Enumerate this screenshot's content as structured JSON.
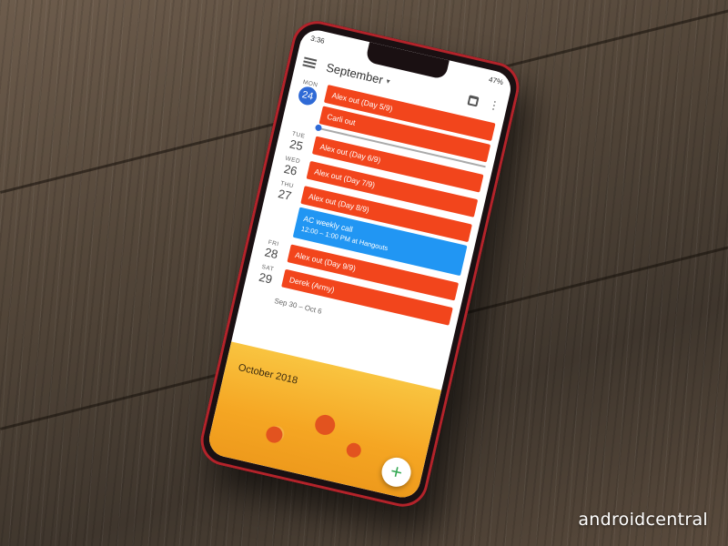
{
  "status": {
    "time": "3:36",
    "battery": "47%"
  },
  "header": {
    "month": "September",
    "caret": "▾",
    "more": "⋮"
  },
  "days": [
    {
      "dow": "MON",
      "num": "24",
      "today": true,
      "events": [
        {
          "title": "Alex out (Day 5/9)",
          "color": "#f2451c"
        },
        {
          "title": "Carli out",
          "color": "#f2451c"
        }
      ],
      "show_now_after_event": true
    },
    {
      "dow": "TUE",
      "num": "25",
      "today": false,
      "events": [
        {
          "title": "Alex out (Day 6/9)",
          "color": "#f2451c"
        }
      ]
    },
    {
      "dow": "WED",
      "num": "26",
      "today": false,
      "events": [
        {
          "title": "Alex out (Day 7/9)",
          "color": "#f2451c"
        }
      ]
    },
    {
      "dow": "THU",
      "num": "27",
      "today": false,
      "events": [
        {
          "title": "Alex out (Day 8/9)",
          "color": "#f2451c"
        },
        {
          "title": "AC weekly call",
          "subtitle": "12:00 – 1:00 PM at Hangouts",
          "color": "#2196f3"
        }
      ]
    },
    {
      "dow": "FRI",
      "num": "28",
      "today": false,
      "events": [
        {
          "title": "Alex out (Day 9/9)",
          "color": "#f2451c"
        }
      ]
    },
    {
      "dow": "SAT",
      "num": "29",
      "today": false,
      "events": [
        {
          "title": "Derek (Army)",
          "color": "#f2451c"
        }
      ]
    }
  ],
  "week_range": "Sep 30 – Oct 6",
  "banner": {
    "title": "October 2018"
  },
  "fab": {
    "label": "+"
  },
  "watermark": "androidcentral"
}
